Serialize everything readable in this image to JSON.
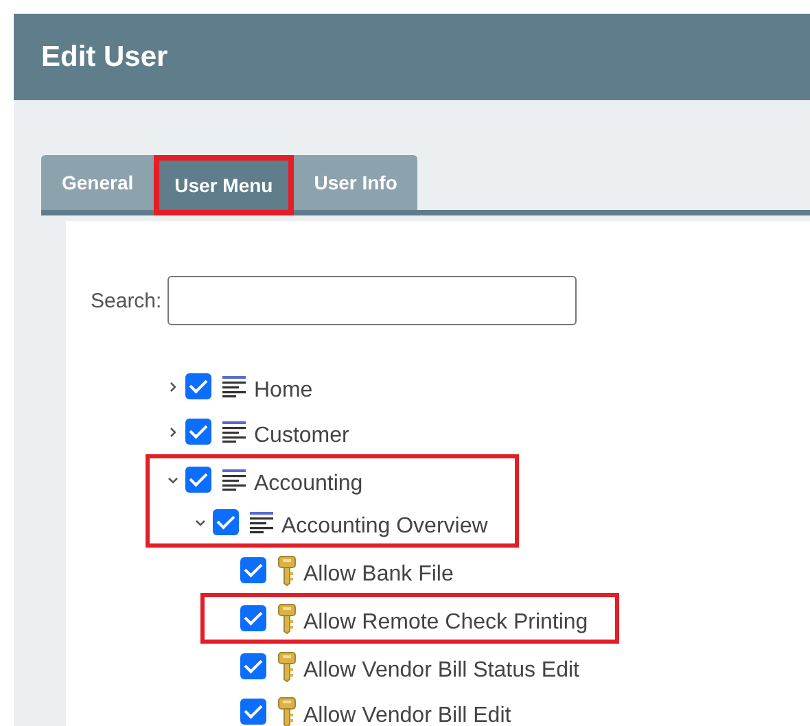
{
  "window": {
    "title": "Edit User"
  },
  "tabs": [
    {
      "label": "General",
      "selected": false,
      "highlighted": false
    },
    {
      "label": "User Menu",
      "selected": true,
      "highlighted": true
    },
    {
      "label": "User Info",
      "selected": false,
      "highlighted": false
    }
  ],
  "search": {
    "label": "Search:"
  },
  "tree": [
    {
      "label": "Home",
      "kind": "menu",
      "checked": true,
      "expanded": false,
      "highlighted": false
    },
    {
      "label": "Customer",
      "kind": "menu",
      "checked": true,
      "expanded": false,
      "highlighted": false
    },
    {
      "label": "Accounting",
      "kind": "menu",
      "checked": true,
      "expanded": true,
      "highlighted": true,
      "children": [
        {
          "label": "Accounting Overview",
          "kind": "menu",
          "checked": true,
          "expanded": true,
          "highlighted": true,
          "children": [
            {
              "label": "Allow Bank File",
              "kind": "permission",
              "checked": true,
              "highlighted": false
            },
            {
              "label": "Allow Remote Check Printing",
              "kind": "permission",
              "checked": true,
              "highlighted": true
            },
            {
              "label": "Allow Vendor Bill Status Edit",
              "kind": "permission",
              "checked": true,
              "highlighted": false
            },
            {
              "label": "Allow Vendor Bill Edit",
              "kind": "permission",
              "checked": true,
              "highlighted": false
            }
          ]
        }
      ]
    }
  ]
}
